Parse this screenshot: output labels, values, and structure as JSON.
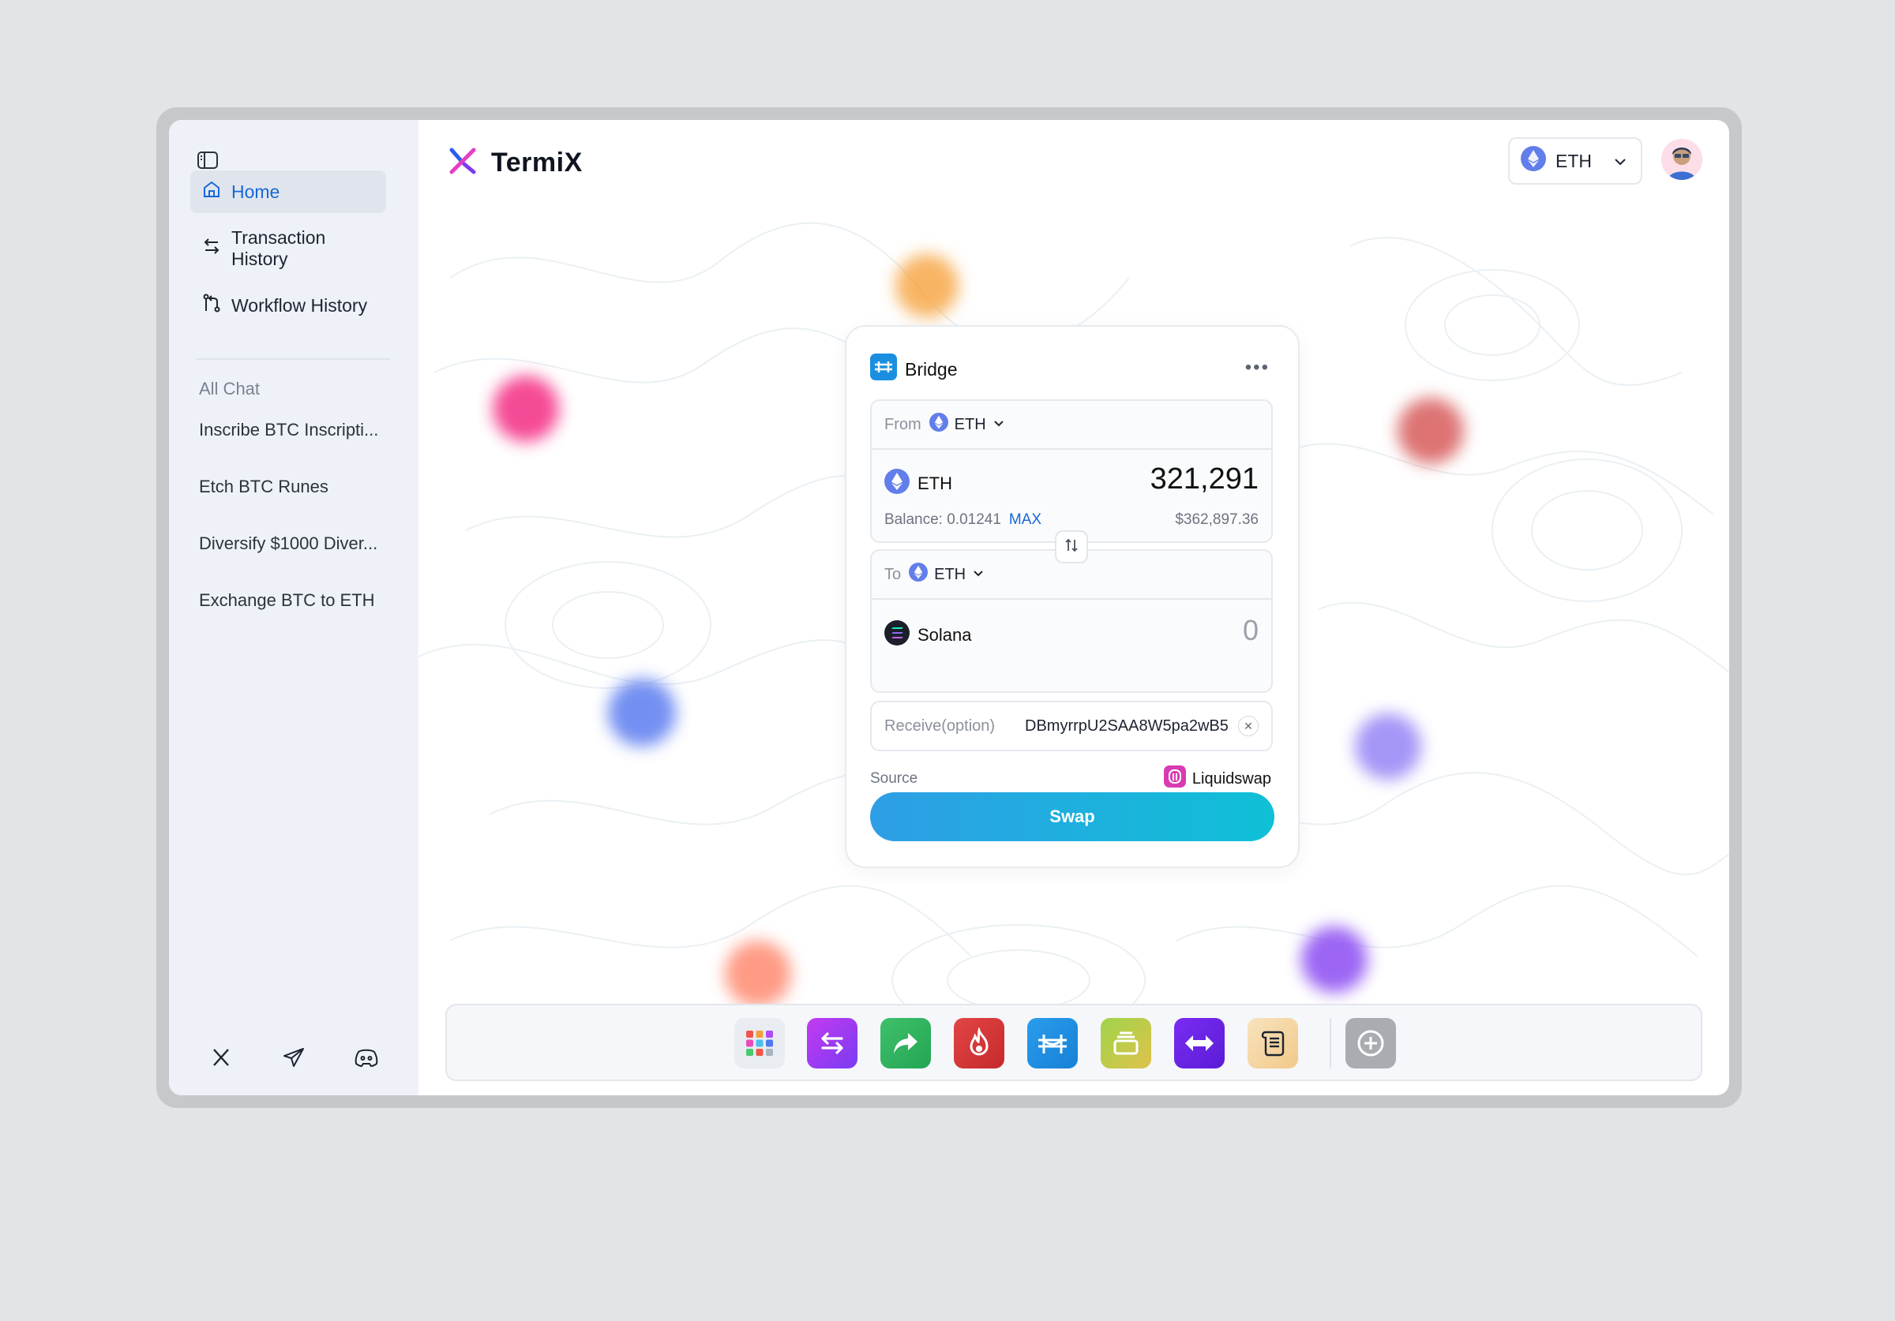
{
  "app": {
    "name": "TermiX"
  },
  "sidebar": {
    "nav": [
      {
        "label": "Home",
        "icon": "home-icon",
        "active": true
      },
      {
        "label": "Transaction History",
        "icon": "arrows-exchange-icon",
        "active": false
      },
      {
        "label": "Workflow History",
        "icon": "git-branch-icon",
        "active": false
      }
    ],
    "section_title": "All Chat",
    "chats": [
      "Inscribe BTC Inscripti...",
      "Etch BTC Runes",
      "Diversify $1000 Diver...",
      "Exchange BTC to ETH"
    ],
    "social": [
      "x-icon",
      "telegram-icon",
      "discord-icon"
    ]
  },
  "header": {
    "network": "ETH"
  },
  "bridge": {
    "title": "Bridge",
    "from": {
      "label": "From",
      "chain": "ETH",
      "token": "ETH",
      "amount": "321,291",
      "balance_label": "Balance: 0.01241",
      "max_label": "MAX",
      "usd_value": "$362,897.36"
    },
    "to": {
      "label": "To",
      "chain": "ETH",
      "token": "Solana",
      "amount": "0"
    },
    "receive": {
      "label": "Receive(option)",
      "value": "DBmyrrpU2SAA8W5pa2wB5"
    },
    "source": {
      "label": "Source",
      "value": "Liquidswap"
    },
    "swap_label": "Swap"
  },
  "dock": {
    "apps": [
      "apps-grid-icon",
      "swap-arrows-icon",
      "share-arrow-icon",
      "fire-icon",
      "bridge-icon",
      "stack-icon",
      "exchange-icon",
      "scroll-icon"
    ],
    "add": "add-circle-icon"
  },
  "colors": {
    "accent": "#1668d8",
    "swap_gradient_start": "#2e9ee6",
    "swap_gradient_end": "#0fc0d6",
    "sidebar_bg": "#eef2f8"
  }
}
